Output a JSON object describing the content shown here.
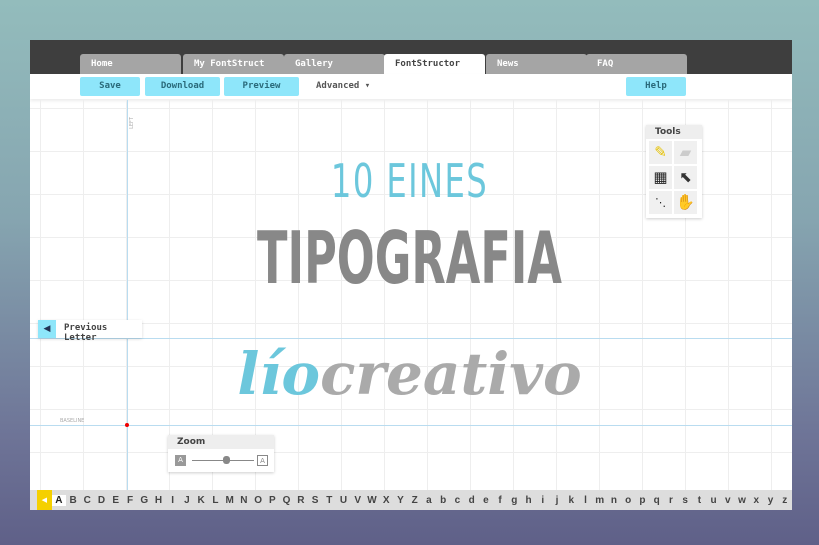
{
  "tabs": [
    {
      "label": "Home"
    },
    {
      "label": "My FontStruct"
    },
    {
      "label": "Gallery"
    },
    {
      "label": "FontStructor",
      "active": true
    },
    {
      "label": "News"
    },
    {
      "label": "FAQ"
    }
  ],
  "toolbar": {
    "save": "Save",
    "download": "Download",
    "preview": "Preview",
    "advanced": "Advanced",
    "help": "Help"
  },
  "canvas": {
    "left_label": "LEFT",
    "baseline_label": "BASELINE"
  },
  "tools": {
    "title": "Tools",
    "items": [
      "pencil-icon",
      "eraser-icon",
      "grid-icon",
      "select-arrow-icon",
      "line-dots-icon",
      "hand-icon"
    ]
  },
  "previous_letter": "Previous Letter",
  "zoom": {
    "title": "Zoom",
    "min": "A",
    "max": "A",
    "level": 0.55
  },
  "charset": {
    "selected": "A",
    "letters": [
      "A",
      "B",
      "C",
      "D",
      "E",
      "F",
      "G",
      "H",
      "I",
      "J",
      "K",
      "L",
      "M",
      "N",
      "O",
      "P",
      "Q",
      "R",
      "S",
      "T",
      "U",
      "V",
      "W",
      "X",
      "Y",
      "Z",
      "a",
      "b",
      "c",
      "d",
      "e",
      "f",
      "g",
      "h",
      "i",
      "j",
      "k",
      "l",
      "m",
      "n",
      "o",
      "p",
      "q",
      "r",
      "s",
      "t",
      "u",
      "v",
      "w",
      "x",
      "y",
      "z"
    ]
  },
  "overlay": {
    "line1": "10 EINES",
    "line2": "TIPOGRAFIA",
    "brand_a": "lío",
    "brand_b": "creativo"
  },
  "colors": {
    "accent": "#8ee6fa",
    "brand_blue": "#6cc7dc",
    "brand_gray": "#888888"
  }
}
